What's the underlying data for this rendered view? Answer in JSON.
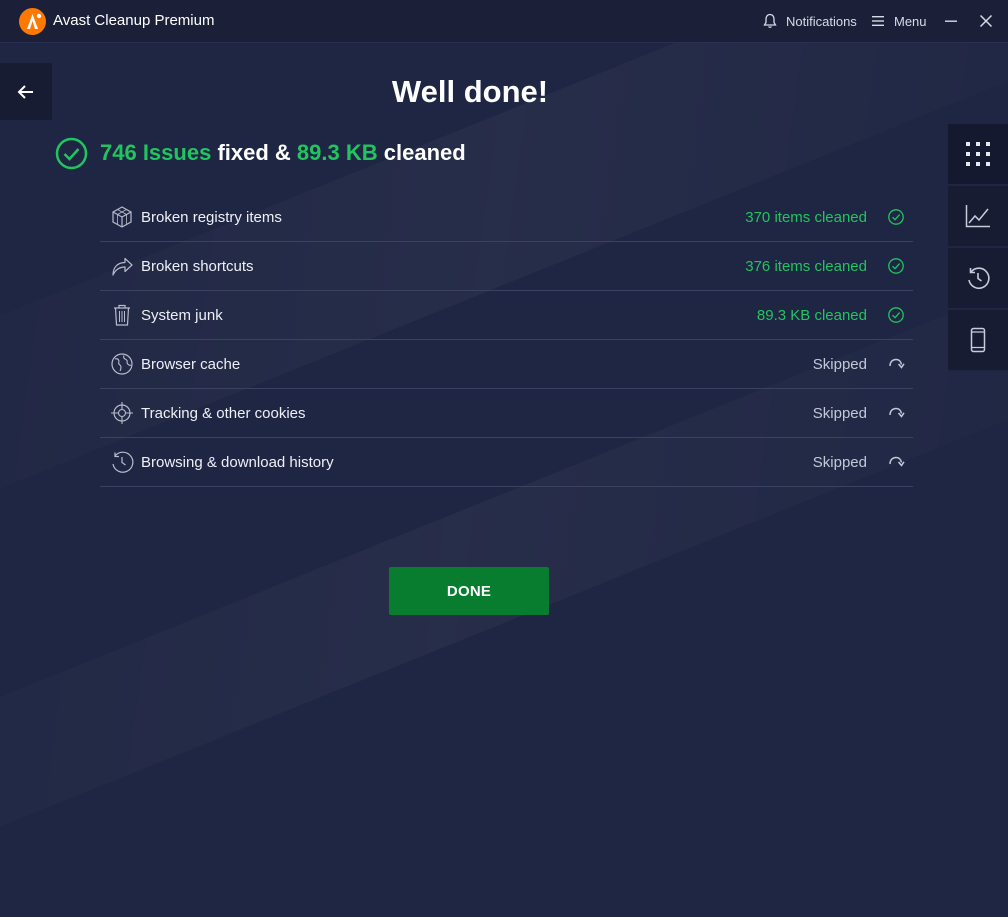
{
  "app": {
    "title": "Avast Cleanup Premium",
    "logo_icon": "avast-logo-icon",
    "brand_color": "#ff7800"
  },
  "titlebar": {
    "notifications_label": "Notifications",
    "menu_label": "Menu"
  },
  "main": {
    "headline": "Well done!",
    "summary": {
      "issues_value": "746 Issues",
      "fixed_word": "fixed &",
      "size_value": "89.3 KB",
      "cleaned_word": "cleaned"
    },
    "results": [
      {
        "label": "Broken registry items",
        "status": "370 items cleaned",
        "state": "cleaned",
        "icon": "registry-cube-icon"
      },
      {
        "label": "Broken shortcuts",
        "status": "376 items cleaned",
        "state": "cleaned",
        "icon": "shortcut-arrow-icon"
      },
      {
        "label": "System junk",
        "status": "89.3 KB cleaned",
        "state": "cleaned",
        "icon": "trash-icon"
      },
      {
        "label": "Browser cache",
        "status": "Skipped",
        "state": "skipped",
        "icon": "globe-icon"
      },
      {
        "label": "Tracking & other cookies",
        "status": "Skipped",
        "state": "skipped",
        "icon": "crosshair-icon"
      },
      {
        "label": "Browsing & download history",
        "status": "Skipped",
        "state": "skipped",
        "icon": "history-icon"
      }
    ],
    "done_label": "DONE"
  },
  "right_rail": [
    "grid-icon",
    "chart-icon",
    "history-icon",
    "mobile-icon"
  ],
  "colors": {
    "background": "#1f2643",
    "success_green": "#21c45e",
    "done_button": "#087c2f"
  }
}
